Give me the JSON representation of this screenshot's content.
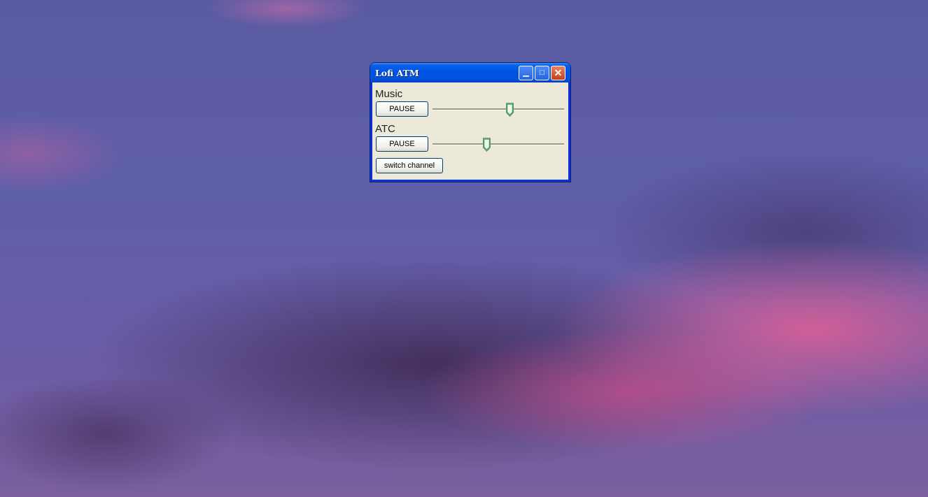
{
  "window": {
    "title": "Lofi ATM",
    "minimize_icon": "minimize-icon",
    "maximize_icon": "maximize-icon",
    "close_icon": "close-icon"
  },
  "music": {
    "label": "Music",
    "pause_label": "PAUSE",
    "volume": 0.59
  },
  "atc": {
    "label": "ATC",
    "pause_label": "PAUSE",
    "volume": 0.41
  },
  "switch_channel_label": "switch channel",
  "colors": {
    "titlebar": "#0054e3",
    "client": "#ece9d8",
    "close_button": "#c8401c",
    "slider_thumb": "#2fa84f"
  }
}
